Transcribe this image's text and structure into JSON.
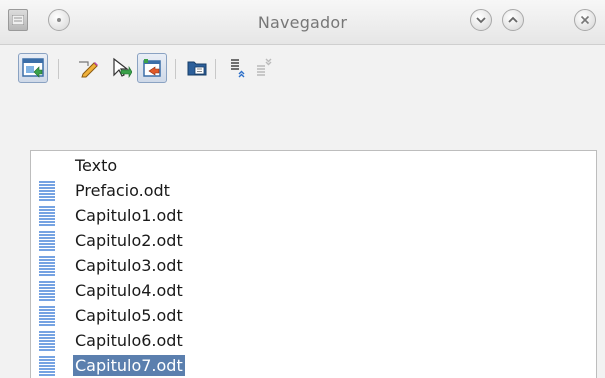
{
  "window": {
    "title": "Navegador"
  },
  "toolbar": {
    "buttons": [
      {
        "name": "toggle-navigator",
        "icon": "navigator-toggle-icon",
        "pressed": true
      },
      {
        "name": "edit",
        "icon": "edit-pencil-icon",
        "pressed": false
      },
      {
        "name": "update",
        "icon": "update-arrow-icon",
        "pressed": false
      },
      {
        "name": "insert",
        "icon": "insert-icon",
        "pressed": true
      },
      {
        "name": "save-as",
        "icon": "save-folder-icon",
        "pressed": false
      },
      {
        "name": "move-up",
        "icon": "move-up-icon",
        "pressed": false
      },
      {
        "name": "move-down",
        "icon": "move-down-icon",
        "pressed": false
      }
    ]
  },
  "list": {
    "items": [
      {
        "label": "Texto",
        "icon": "",
        "selected": false
      },
      {
        "label": "Prefacio.odt",
        "icon": "subdocument-icon",
        "selected": false
      },
      {
        "label": "Capitulo1.odt",
        "icon": "subdocument-icon",
        "selected": false
      },
      {
        "label": "Capitulo2.odt",
        "icon": "subdocument-icon",
        "selected": false
      },
      {
        "label": "Capitulo3.odt",
        "icon": "subdocument-icon",
        "selected": false
      },
      {
        "label": "Capitulo4.odt",
        "icon": "subdocument-icon",
        "selected": false
      },
      {
        "label": "Capitulo5.odt",
        "icon": "subdocument-icon",
        "selected": false
      },
      {
        "label": "Capitulo6.odt",
        "icon": "subdocument-icon",
        "selected": false
      },
      {
        "label": "Capitulo7.odt",
        "icon": "subdocument-icon",
        "selected": true
      }
    ]
  },
  "colors": {
    "selection": "#5b7fae",
    "doc_icon": "#3a7bd5"
  }
}
